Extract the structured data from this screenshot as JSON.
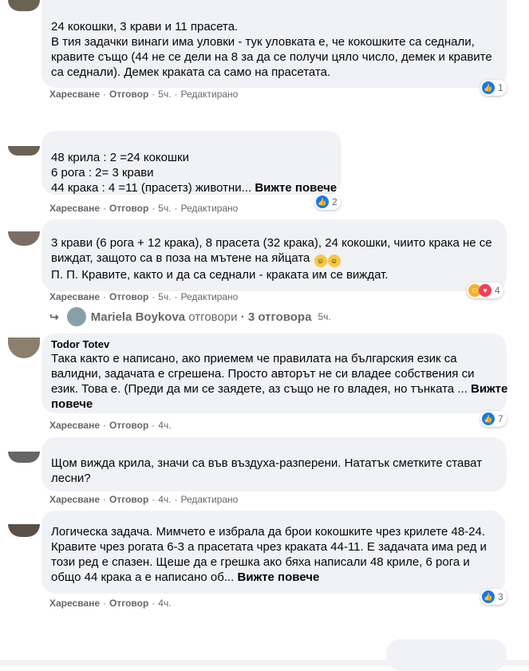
{
  "labels": {
    "like": "Харесване",
    "reply": "Отговор",
    "edited": "Редактирано",
    "see_more": "Вижте повече",
    "sep": "·"
  },
  "comments": [
    {
      "lines": [
        "24 кокошки, 3 крави и 11 прасета.",
        "В тия задачки винаги има уловки - тук уловката е, че кокошките са седнали,",
        "кравите също (44 не се дели на 8 за да се получи цяло число, демек и кравите",
        "са седнали). Демек краката са само на прасетата."
      ],
      "time": "5ч.",
      "edited": true,
      "reactions": 1
    },
    {
      "lines": [
        "48 крила : 2 =24 кокошки",
        "6 рога : 2= 3 крави",
        "44 крака : 4 =11 (прасетз) животни..."
      ],
      "time": "5ч.",
      "edited": true,
      "reactions": 2
    },
    {
      "lines": [
        "3 крави (6 рога + 12 крака), 8 прасета (32 крака), 24 кокошки, чиито крака не се",
        "виждат, защото са в поза на мътене на яйцата",
        "П. П. Кравите, както и да са седнали - краката им се виждат."
      ],
      "time": "5ч.",
      "edited": true,
      "reactions": 4,
      "replies": {
        "name": "Mariela Boykova",
        "text": "отговори",
        "count": "3 отговора",
        "time": "5ч."
      }
    },
    {
      "author": "Todor Totev",
      "lines": [
        "Така както е написано, ако приемем че правилата на българския език са",
        "валидни, задачата е сгрешена. Просто авторът не си владее собствения си",
        "език. Това е. (Преди да ми се заядете, аз също не го владея, но тънката ..."
      ],
      "see_more_line2": "повече",
      "time": "4ч.",
      "edited": false,
      "reactions": 7
    },
    {
      "lines": [
        "Щом вижда крила, значи са във въздуха-разперени. Нататък сметките стават",
        "лесни?"
      ],
      "time": "4ч.",
      "edited": true
    },
    {
      "lines": [
        "Логическа задача. Мимчето е избрала да брои кокошките чрез крилете 48-24.",
        "Кравите чрез рогата 6-3 а прасетата чрез краката 44-11. Е задачата има ред и",
        "този ред е спазен. Щеше да е грешка ако бяха написали 48 криле, 6 рога и",
        "общо 44 крака а е написано об..."
      ],
      "time": "4ч.",
      "edited": false,
      "reactions": 3
    }
  ]
}
